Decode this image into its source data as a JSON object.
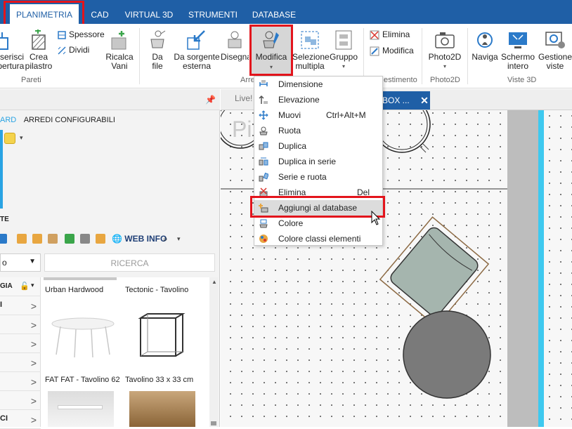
{
  "top_tabs": [
    {
      "label": "PLANIMETRIA",
      "active": true
    },
    {
      "label": "CAD"
    },
    {
      "label": "VIRTUAL 3D"
    },
    {
      "label": "STRUMENTI"
    },
    {
      "label": "DATABASE"
    }
  ],
  "ribbon": {
    "pareti": {
      "inserisci": "Inserisci\napertura",
      "crea_pilastro": "Crea\npilastro",
      "spessore": "Spessore",
      "dividi": "Dividi",
      "ricalca_vani": "Ricalca\nVani",
      "group_label": "Pareti"
    },
    "da_file": "Da\nfile",
    "da_sorgente": "Da sorgente\nesterna",
    "disegna": "Disegna",
    "arredi_group_partial": "Arre",
    "modifica": "Modifica",
    "selezione_multipla": "Selezione\nmultipla",
    "gruppo": "Gruppo",
    "elimina": "Elimina",
    "modifica_small": "Modifica",
    "gestimento_partial": "estimento",
    "photo2d": "Photo2D",
    "photo2d_group": "Photo2D",
    "naviga": "Naviga",
    "schermo_intero": "Schermo\nintero",
    "gestione_viste": "Gestione\nviste",
    "viste3d_group": "Viste 3D"
  },
  "left_panel": {
    "tabs": [
      "ARD",
      "ARREDI CONFIGURABILI"
    ],
    "section_title": "TE",
    "webinfo": "WEB INFO",
    "select_value": "o",
    "search_button": "RICERCA",
    "category_header": "GIA",
    "categories": [
      "I",
      "",
      "",
      "",
      "",
      "",
      "CI"
    ],
    "products": [
      {
        "name": "Urban Hardwood"
      },
      {
        "name": "Tectonic - Tavolino"
      },
      {
        "name": "FAT FAT - Tavolino 62"
      },
      {
        "name": "Tavolino 33 x 33 cm"
      }
    ]
  },
  "doc_tabs": {
    "live": "Live!",
    "active": "BOX ...",
    "close": "✕"
  },
  "canvas": {
    "big_label": "Pi"
  },
  "menu": {
    "items": [
      {
        "label": "Dimensione",
        "shortcut": "",
        "icon": "dimension-icon"
      },
      {
        "label": "Elevazione",
        "shortcut": "",
        "icon": "elevation-icon"
      },
      {
        "label": "Muovi",
        "shortcut": "Ctrl+Alt+M",
        "icon": "move-icon"
      },
      {
        "label": "Ruota",
        "shortcut": "",
        "icon": "rotate-icon"
      },
      {
        "label": "Duplica",
        "shortcut": "",
        "icon": "duplicate-icon"
      },
      {
        "label": "Duplica in serie",
        "shortcut": "",
        "icon": "duplicate-series-icon"
      },
      {
        "label": "Serie e ruota",
        "shortcut": "",
        "icon": "series-rotate-icon"
      },
      {
        "label": "Elimina",
        "shortcut": "Del",
        "icon": "delete-icon"
      },
      {
        "label": "Aggiungi al database",
        "shortcut": "",
        "icon": "add-database-icon",
        "highlighted": true
      },
      {
        "label": "Colore",
        "shortcut": "",
        "icon": "color-icon"
      },
      {
        "label": "Colore classi elementi",
        "shortcut": "",
        "icon": "class-color-icon"
      }
    ]
  },
  "colors": {
    "brand_blue": "#1f5fa6",
    "highlight_red": "#e3141c",
    "accent_cyan": "#3ec9ef"
  }
}
